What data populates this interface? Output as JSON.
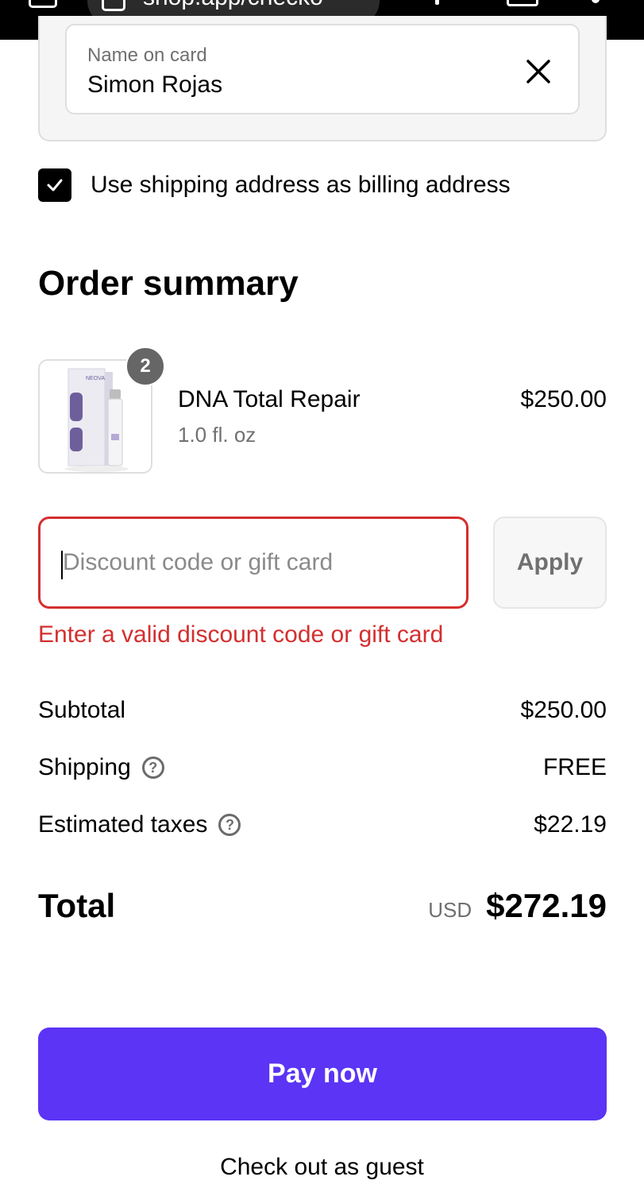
{
  "browser": {
    "url_text": "shop.app/checko"
  },
  "card": {
    "name_label": "Name on card",
    "name_value": "Simon Rojas",
    "clear_icon": "close-icon"
  },
  "billing": {
    "checked": true,
    "label": "Use shipping address as billing address"
  },
  "summary": {
    "title": "Order summary",
    "product": {
      "quantity": "2",
      "name": "DNA Total Repair",
      "variant": "1.0 fl. oz",
      "price": "$250.00",
      "brand_mark": "NEOVA"
    },
    "discount": {
      "placeholder": "Discount code or gift card",
      "value": "",
      "apply_label": "Apply",
      "error": "Enter a valid discount code or gift card"
    },
    "lines": {
      "subtotal_label": "Subtotal",
      "subtotal_value": "$250.00",
      "shipping_label": "Shipping",
      "shipping_value": "FREE",
      "taxes_label": "Estimated taxes",
      "taxes_value": "$22.19"
    },
    "total": {
      "label": "Total",
      "currency": "USD",
      "amount": "$272.19"
    }
  },
  "actions": {
    "pay_label": "Pay now",
    "guest_label": "Check out as guest"
  },
  "colors": {
    "accent": "#5b34f5",
    "error": "#d32f2f",
    "muted_text": "#707070"
  }
}
